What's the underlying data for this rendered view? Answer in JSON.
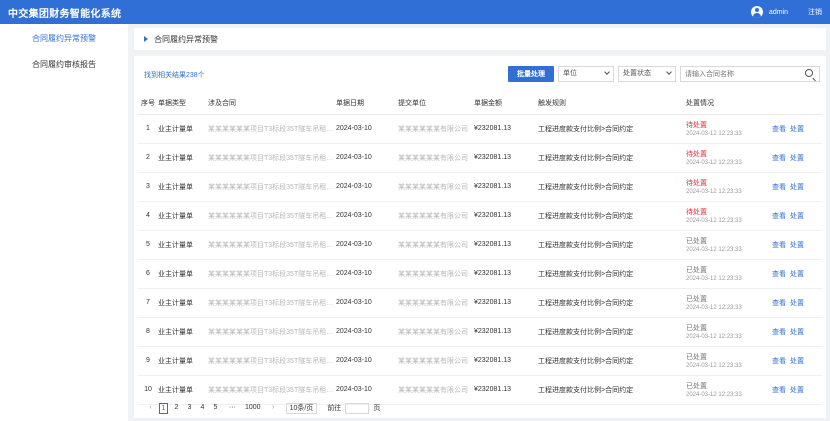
{
  "header": {
    "title": "中交集团财务智能化系统",
    "user": "admin",
    "logout": "注销"
  },
  "sidebar": {
    "items": [
      {
        "label": "合同履约异常预警",
        "active": true
      },
      {
        "label": "合同履约审核报告",
        "active": false
      }
    ]
  },
  "page_title": "合同履约异常预警",
  "toolbar": {
    "count_text": "找到相关结果238个",
    "batch_button": "批量处理",
    "unit_select": "单位",
    "status_select": "处置状态",
    "search_placeholder": "请输入合同名称"
  },
  "table": {
    "columns": [
      "序号",
      "单据类型",
      "涉及合同",
      "单据日期",
      "提交单位",
      "单据金额",
      "触发规则",
      "处置情况"
    ],
    "rows": [
      {
        "no": "1",
        "type": "业主计量单",
        "contract": "某某某某某某项目T3标段35T隧车吊租赁合同",
        "date": "2024-03-10",
        "unit": "某某某某某某有限公司",
        "amount": "¥232081.13",
        "rule": "工程进度款支付比例>合同约定",
        "status": "待处置",
        "status_kind": "pending",
        "time": "2024-03-12 12:23:33"
      },
      {
        "no": "2",
        "type": "业主计量单",
        "contract": "某某某某某某项目T3标段35T隧车吊租赁合同",
        "date": "2024-03-10",
        "unit": "某某某某某某有限公司",
        "amount": "¥232081.13",
        "rule": "工程进度款支付比例>合同约定",
        "status": "待处置",
        "status_kind": "pending",
        "time": "2024-03-12 12:23:33"
      },
      {
        "no": "3",
        "type": "业主计量单",
        "contract": "某某某某某某项目T3标段35T隧车吊租赁合同",
        "date": "2024-03-10",
        "unit": "某某某某某某有限公司",
        "amount": "¥232081.13",
        "rule": "工程进度款支付比例>合同约定",
        "status": "待处置",
        "status_kind": "pending",
        "time": "2024-03-12 12:23:33"
      },
      {
        "no": "4",
        "type": "业主计量单",
        "contract": "某某某某某某项目T3标段35T隧车吊租赁合同",
        "date": "2024-03-10",
        "unit": "某某某某某某有限公司",
        "amount": "¥232081.13",
        "rule": "工程进度款支付比例>合同约定",
        "status": "待处置",
        "status_kind": "pending",
        "time": "2024-03-12 12:23:33"
      },
      {
        "no": "5",
        "type": "业主计量单",
        "contract": "某某某某某某项目T3标段35T隧车吊租赁合同",
        "date": "2024-03-10",
        "unit": "某某某某某某有限公司",
        "amount": "¥232081.13",
        "rule": "工程进度款支付比例>合同约定",
        "status": "已处置",
        "status_kind": "done",
        "time": "2024-03-12 12:23:33"
      },
      {
        "no": "6",
        "type": "业主计量单",
        "contract": "某某某某某某项目T3标段35T隧车吊租赁合同",
        "date": "2024-03-10",
        "unit": "某某某某某某有限公司",
        "amount": "¥232081.13",
        "rule": "工程进度款支付比例>合同约定",
        "status": "已处置",
        "status_kind": "done",
        "time": "2024-03-12 12:23:33"
      },
      {
        "no": "7",
        "type": "业主计量单",
        "contract": "某某某某某某项目T3标段35T隧车吊租赁合同",
        "date": "2024-03-10",
        "unit": "某某某某某某有限公司",
        "amount": "¥232081.13",
        "rule": "工程进度款支付比例>合同约定",
        "status": "已处置",
        "status_kind": "done",
        "time": "2024-03-12 12:23:33"
      },
      {
        "no": "8",
        "type": "业主计量单",
        "contract": "某某某某某某项目T3标段35T隧车吊租赁合同",
        "date": "2024-03-10",
        "unit": "某某某某某某有限公司",
        "amount": "¥232081.13",
        "rule": "工程进度款支付比例>合同约定",
        "status": "已处置",
        "status_kind": "done",
        "time": "2024-03-12 12:23:33"
      },
      {
        "no": "9",
        "type": "业主计量单",
        "contract": "某某某某某某项目T3标段35T隧车吊租赁合同",
        "date": "2024-03-10",
        "unit": "某某某某某某有限公司",
        "amount": "¥232081.13",
        "rule": "工程进度款支付比例>合同约定",
        "status": "已处置",
        "status_kind": "done",
        "time": "2024-03-12 12:23:33"
      },
      {
        "no": "10",
        "type": "业主计量单",
        "contract": "某某某某某某项目T3标段35T隧车吊租赁合同",
        "date": "2024-03-10",
        "unit": "某某某某某某有限公司",
        "amount": "¥232081.13",
        "rule": "工程进度款支付比例>合同约定",
        "status": "已处置",
        "status_kind": "done",
        "time": "2024-03-12 12:23:33"
      }
    ],
    "op_view": "查看",
    "op_handle": "处置"
  },
  "pager": {
    "prev": "‹",
    "pages": [
      "1",
      "2",
      "3",
      "4",
      "5"
    ],
    "ellipsis": "···",
    "last": "1000",
    "next": "›",
    "page_size": "10条/页",
    "goto_prefix": "前往",
    "goto_suffix": "页"
  },
  "colors": {
    "primary": "#2f6fd6",
    "danger": "#e0303a"
  }
}
